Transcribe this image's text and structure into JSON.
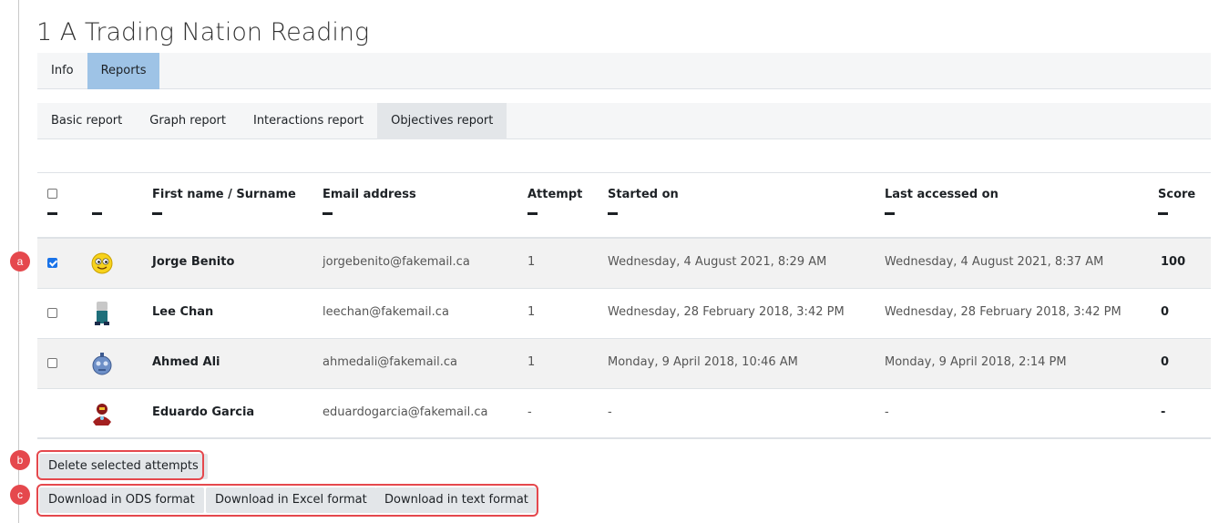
{
  "page_title": "1 A Trading Nation Reading",
  "primary_tabs": [
    {
      "label": "Info",
      "active": false
    },
    {
      "label": "Reports",
      "active": true
    }
  ],
  "secondary_tabs": [
    {
      "label": "Basic report",
      "active": true
    },
    {
      "label": "Graph report",
      "active": false
    },
    {
      "label": "Interactions report",
      "active": false
    },
    {
      "label": "Objectives report",
      "active": false
    }
  ],
  "table": {
    "headers": {
      "name": "First name / Surname",
      "email": "Email address",
      "attempt": "Attempt",
      "started": "Started on",
      "last_accessed": "Last accessed on",
      "score": "Score"
    },
    "rows": [
      {
        "checked": true,
        "avatar": "smiley-avatar-icon",
        "name": "Jorge Benito",
        "email": "jorgebenito@fakemail.ca",
        "attempt": "1",
        "started": "Wednesday, 4 August 2021, 8:29 AM",
        "last_accessed": "Wednesday, 4 August 2021, 8:37 AM",
        "score": "100"
      },
      {
        "checked": false,
        "avatar": "person-avatar-icon",
        "name": "Lee Chan",
        "email": "leechan@fakemail.ca",
        "attempt": "1",
        "started": "Wednesday, 28 February 2018, 3:42 PM",
        "last_accessed": "Wednesday, 28 February 2018, 3:42 PM",
        "score": "0"
      },
      {
        "checked": false,
        "avatar": "robot-avatar-icon",
        "name": "Ahmed Ali",
        "email": "ahmedali@fakemail.ca",
        "attempt": "1",
        "started": "Monday, 9 April 2018, 10:46 AM",
        "last_accessed": "Monday, 9 April 2018, 2:14 PM",
        "score": "0"
      },
      {
        "checked": null,
        "avatar": "hero-avatar-icon",
        "name": "Eduardo Garcia",
        "email": "eduardogarcia@fakemail.ca",
        "attempt": "-",
        "started": "-",
        "last_accessed": "-",
        "score": "-"
      }
    ]
  },
  "buttons": {
    "delete": "Delete selected attempts",
    "download_ods": "Download in ODS format",
    "download_excel": "Download in Excel format",
    "download_text": "Download in text format"
  },
  "callouts": {
    "a": "a",
    "b": "b",
    "c": "c"
  },
  "colors": {
    "active_tab": "#9ec3e6",
    "callout": "#e5484d",
    "checkbox_checked": "#1a73e8"
  }
}
